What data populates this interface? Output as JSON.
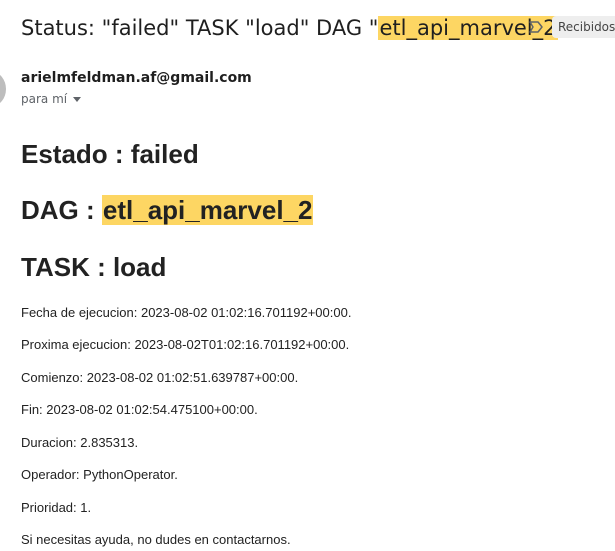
{
  "email": {
    "subject_prefix": "Status: \"failed\" TASK \"load\" DAG \"",
    "subject_highlight": "etl_api_marvel_2",
    "subject_suffix": "\"",
    "label_chip": "Recibidos",
    "sender": "arielmfeldman.af@gmail.com",
    "recipient": "para mí"
  },
  "body": {
    "estado_heading": "Estado : failed",
    "dag_prefix": "DAG : ",
    "dag_highlight": "etl_api_marvel_2",
    "task_heading": "TASK : load",
    "lines": [
      "Fecha de ejecucion: 2023-08-02 01:02:16.701192+00:00.",
      "Proxima ejecucion: 2023-08-02T01:02:16.701192+00:00.",
      "Comienzo: 2023-08-02 01:02:51.639787+00:00.",
      "Fin: 2023-08-02 01:02:54.475100+00:00.",
      "Duracion: 2.835313.",
      "Operador: PythonOperator.",
      "Prioridad: 1.",
      "Si necesitas ayuda, no dudes en contactarnos."
    ]
  },
  "icons": {
    "label": "label-icon",
    "avatar": "avatar"
  }
}
